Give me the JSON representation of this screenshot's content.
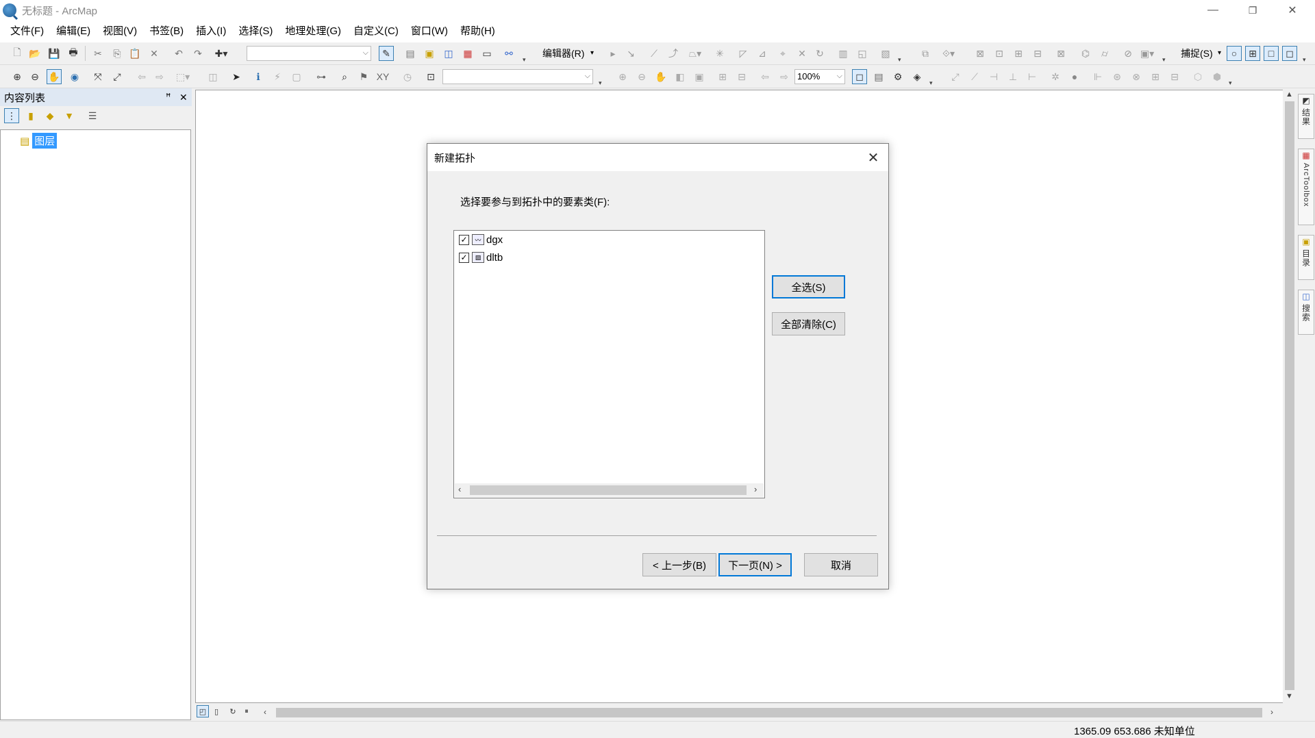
{
  "window": {
    "title": "无标题 - ArcMap",
    "minimize": "—",
    "restore": "❐",
    "close": "✕"
  },
  "menu": [
    "文件(F)",
    "编辑(E)",
    "视图(V)",
    "书签(B)",
    "插入(I)",
    "选择(S)",
    "地理处理(G)",
    "自定义(C)",
    "窗口(W)",
    "帮助(H)"
  ],
  "toolbar1": {
    "editor_label": "编辑器(R)",
    "snap_label": "捕捉(S)"
  },
  "toolbar2": {
    "zoom_value": "100%"
  },
  "toc": {
    "title": "内容列表",
    "pin": "ꟸ",
    "close": "✕",
    "root_layer": "图层"
  },
  "right_dock": {
    "tabs": [
      "结果",
      "ArcToolbox",
      "目录",
      "搜索"
    ]
  },
  "dialog": {
    "title": "新建拓扑",
    "close": "✕",
    "prompt": "选择要参与到拓扑中的要素类(F):",
    "items": [
      {
        "name": "dgx",
        "checked": true,
        "icon": "line-feature-icon"
      },
      {
        "name": "dltb",
        "checked": true,
        "icon": "polygon-feature-icon"
      }
    ],
    "select_all": "全选(S)",
    "clear_all": "全部清除(C)",
    "back": "< 上一步(B)",
    "next": "下一页(N) >",
    "cancel": "取消"
  },
  "status": {
    "coordinates": "1365.09  653.686 未知单位"
  },
  "colors": {
    "accent": "#0078d7",
    "selection_bg": "#3399ff"
  }
}
